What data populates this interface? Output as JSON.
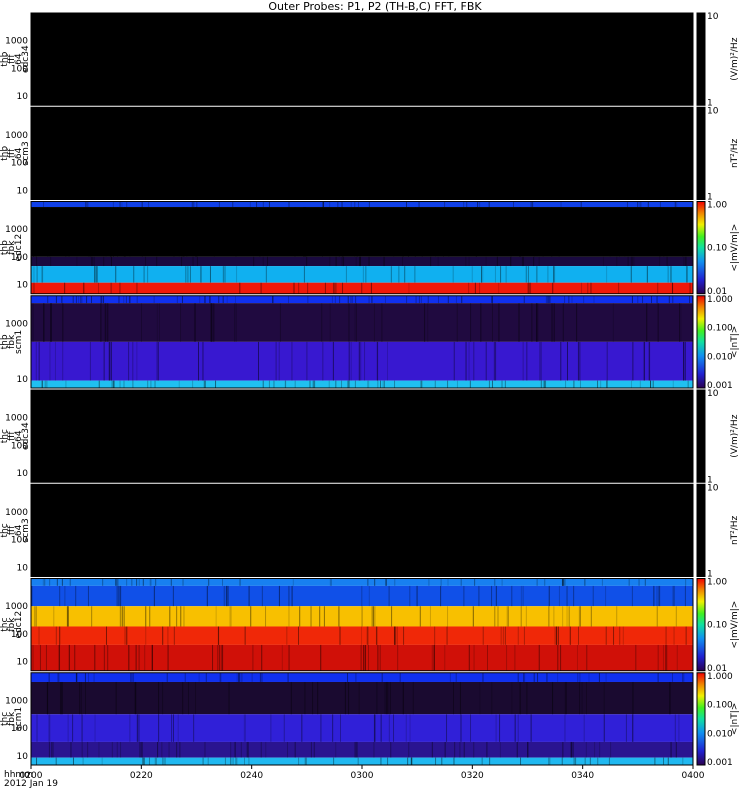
{
  "title": "Outer Probes: P1, P2 (TH-B,C) FFT, FBK",
  "x_axis": {
    "ticks": [
      "0200",
      "0220",
      "0240",
      "0300",
      "0320",
      "0340",
      "0400"
    ],
    "left_labels": [
      "hhmm",
      "2012 Jan 19"
    ]
  },
  "chart_data": {
    "type": "heatmap",
    "title": "Outer Probes: P1, P2 (TH-B,C) FFT, FBK",
    "panels": [
      {
        "id": "thb-fff-edc34",
        "ylabel": [
          "thb",
          "fff",
          "64",
          "edc34"
        ],
        "yticks": [
          "1000",
          "100",
          "10"
        ],
        "colorbar": {
          "label": "(V/m)²/Hz",
          "ticks": [
            "10",
            "1"
          ],
          "type": "black"
        },
        "bands": [
          {
            "from": 0,
            "to": 1,
            "color": "#000000"
          }
        ]
      },
      {
        "id": "thb-fff-scm3",
        "ylabel": [
          "thb",
          "fff",
          "64",
          "scm3"
        ],
        "yticks": [
          "1000",
          "100",
          "10"
        ],
        "colorbar": {
          "label": "nT²/Hz",
          "ticks": [
            "10",
            "1"
          ],
          "type": "black"
        },
        "bands": [
          {
            "from": 0,
            "to": 1,
            "color": "#000000"
          }
        ]
      },
      {
        "id": "thb-fbk-edc12",
        "ylabel": [
          "thb",
          "fbk",
          "edc12"
        ],
        "yticks": [
          "1000",
          "100",
          "10"
        ],
        "colorbar": {
          "label": "<|mV/m|>",
          "ticks": [
            "1.00",
            "0.10",
            "0.01"
          ],
          "type": "rainbow"
        },
        "bands": [
          {
            "from": 0.0,
            "to": 0.06,
            "color": "#1040e8"
          },
          {
            "from": 0.06,
            "to": 0.6,
            "color": "#000000"
          },
          {
            "from": 0.6,
            "to": 0.7,
            "color": "#1a0a40"
          },
          {
            "from": 0.7,
            "to": 0.88,
            "color": "#10b0f0"
          },
          {
            "from": 0.88,
            "to": 1.0,
            "color": "#f01808"
          }
        ]
      },
      {
        "id": "thb-fbk-scm1",
        "ylabel": [
          "thb",
          "fbk",
          "scm1"
        ],
        "yticks": [
          "1000",
          "10"
        ],
        "colorbar": {
          "label": "<|nT|>",
          "ticks": [
            "1.000",
            "0.100",
            "0.010",
            "0.001"
          ],
          "type": "rainbow"
        },
        "bands": [
          {
            "from": 0.0,
            "to": 0.08,
            "color": "#1030f0"
          },
          {
            "from": 0.08,
            "to": 0.5,
            "color": "#200a40"
          },
          {
            "from": 0.5,
            "to": 0.92,
            "color": "#3818d0"
          },
          {
            "from": 0.92,
            "to": 1.0,
            "color": "#20c0f0"
          }
        ]
      },
      {
        "id": "thc-fff-edc34",
        "ylabel": [
          "thc",
          "fff",
          "64",
          "edc34"
        ],
        "yticks": [
          "1000",
          "100",
          "10"
        ],
        "colorbar": {
          "label": "(V/m)²/Hz",
          "ticks": [
            "10",
            "1"
          ],
          "type": "black"
        },
        "bands": [
          {
            "from": 0,
            "to": 1,
            "color": "#000000"
          }
        ]
      },
      {
        "id": "thc-fff-scm3",
        "ylabel": [
          "thc",
          "fff",
          "64",
          "scm3"
        ],
        "yticks": [
          "1000",
          "100",
          "10"
        ],
        "colorbar": {
          "label": "nT²/Hz",
          "ticks": [
            "10",
            "1"
          ],
          "type": "black"
        },
        "bands": [
          {
            "from": 0,
            "to": 1,
            "color": "#000000"
          }
        ]
      },
      {
        "id": "thc-fbk-edc12",
        "ylabel": [
          "thc",
          "fbk",
          "edc12"
        ],
        "yticks": [
          "1000",
          "100",
          "10"
        ],
        "colorbar": {
          "label": "<|mV/m|>",
          "ticks": [
            "1.00",
            "0.10",
            "0.01"
          ],
          "type": "rainbow"
        },
        "bands": [
          {
            "from": 0.0,
            "to": 0.08,
            "color": "#1880f0"
          },
          {
            "from": 0.08,
            "to": 0.3,
            "color": "#1050e8"
          },
          {
            "from": 0.3,
            "to": 0.52,
            "color": "#f8c000"
          },
          {
            "from": 0.52,
            "to": 0.72,
            "color": "#f02808"
          },
          {
            "from": 0.72,
            "to": 1.0,
            "color": "#d01008"
          }
        ]
      },
      {
        "id": "thc-fbk-scm1",
        "ylabel": [
          "thc",
          "fbk",
          "scm1"
        ],
        "yticks": [
          "1000",
          "100",
          "10"
        ],
        "colorbar": {
          "label": "<|nT|>",
          "ticks": [
            "1.000",
            "0.100",
            "0.010",
            "0.001"
          ],
          "type": "rainbow"
        },
        "bands": [
          {
            "from": 0.0,
            "to": 0.1,
            "color": "#1030f0"
          },
          {
            "from": 0.1,
            "to": 0.45,
            "color": "#1a0a30"
          },
          {
            "from": 0.45,
            "to": 0.75,
            "color": "#3020d8"
          },
          {
            "from": 0.75,
            "to": 0.92,
            "color": "#2a1490"
          },
          {
            "from": 0.92,
            "to": 1.0,
            "color": "#20b8f0"
          }
        ]
      }
    ]
  }
}
